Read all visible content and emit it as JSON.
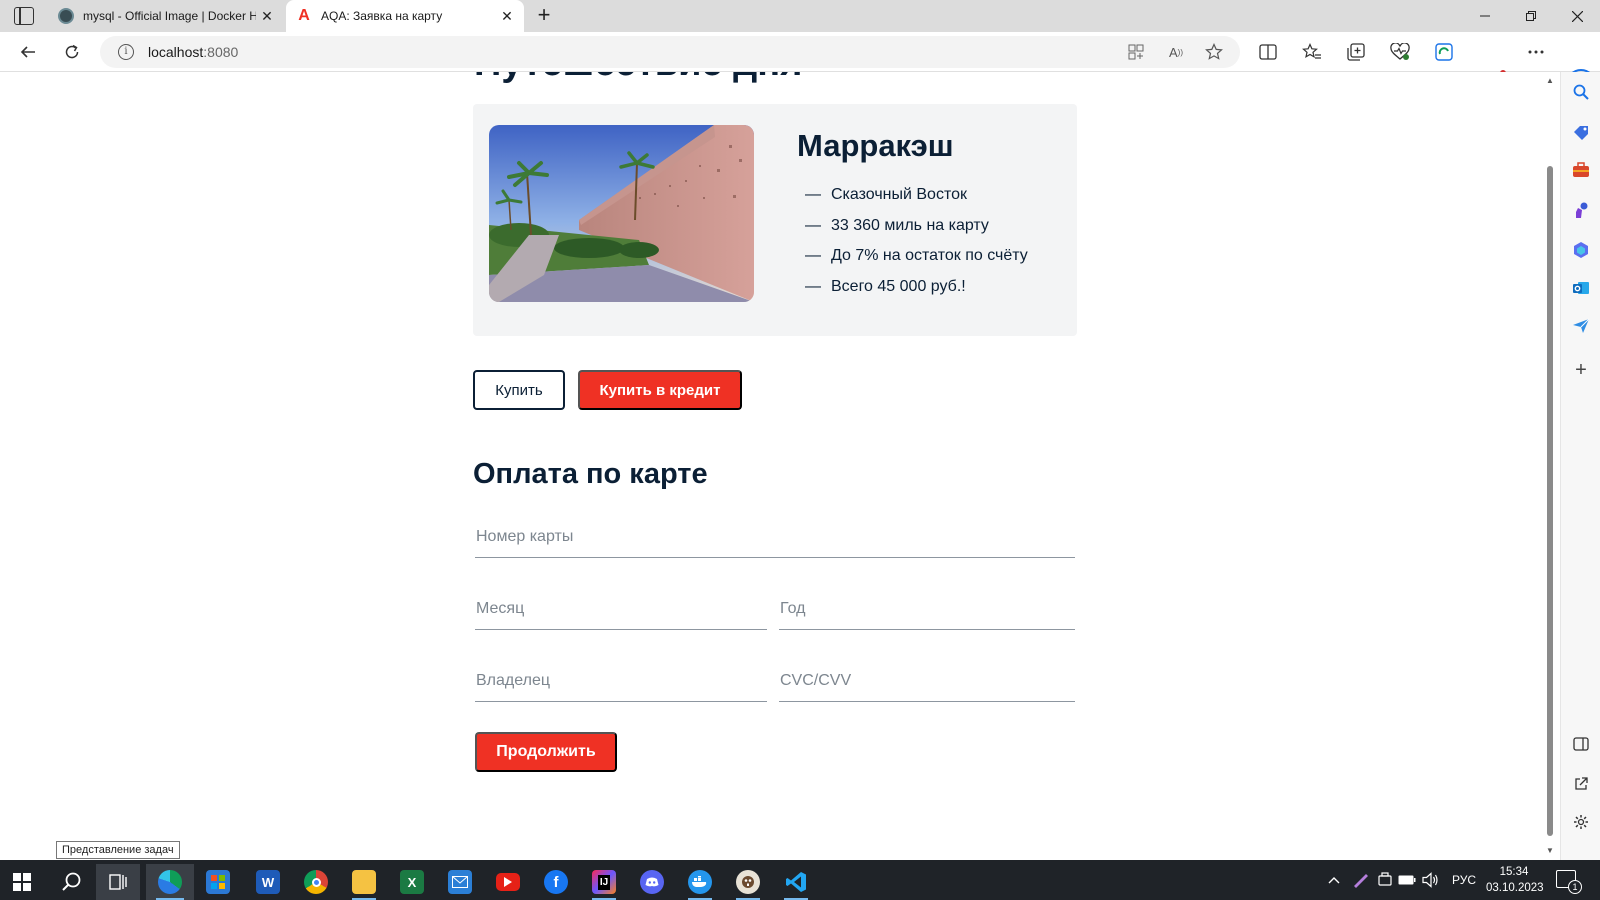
{
  "browser": {
    "tabs": [
      {
        "title": "mysql - Official Image | Docker H",
        "favicon": "docker-favicon",
        "active": false
      },
      {
        "title": "AQA: Заявка на карту",
        "favicon": "alfa-a-favicon",
        "active": true
      }
    ],
    "new_tab_glyph": "+",
    "close_glyph": "✕",
    "address": {
      "host": "localhost",
      "port": ":8080"
    }
  },
  "page": {
    "heading_cut": "Путешествие дня",
    "offer": {
      "title": "Марракэш",
      "features": [
        "Сказочный Восток",
        "33 360 миль на карту",
        "До 7% на остаток по счёту",
        "Всего 45 000 руб.!"
      ],
      "dash": "—"
    },
    "buttons": {
      "buy": "Купить",
      "buy_credit": "Купить в кредит",
      "continue": "Продолжить"
    },
    "form": {
      "title": "Оплата по карте",
      "card_number_placeholder": "Номер карты",
      "month_placeholder": "Месяц",
      "year_placeholder": "Год",
      "owner_placeholder": "Владелец",
      "cvc_placeholder": "CVC/CVV"
    }
  },
  "tooltip": "Представление задач",
  "taskbar": {
    "language": "РУС",
    "time": "15:34",
    "date": "03.10.2023",
    "notification_count": "1"
  },
  "colors": {
    "accent_red": "#ef3124",
    "text_dark": "#0b1f35",
    "offer_bg": "#f3f4f5",
    "taskbar_bg": "#1f2328"
  }
}
